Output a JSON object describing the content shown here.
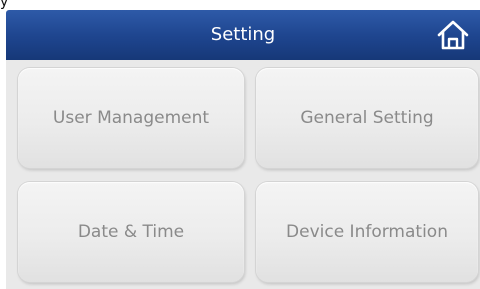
{
  "header": {
    "title": "Setting",
    "home_icon": "home-icon"
  },
  "top_glyph": "y",
  "menu": {
    "items": [
      {
        "label": "User Management"
      },
      {
        "label": "General Setting"
      },
      {
        "label": "Date & Time"
      },
      {
        "label": "Device Information"
      }
    ]
  },
  "colors": {
    "header_bg": "#1f4690",
    "header_text": "#ffffff",
    "body_bg": "#e9e9e9",
    "tile_bg": "#ececec",
    "tile_text": "#8a8a8a"
  }
}
